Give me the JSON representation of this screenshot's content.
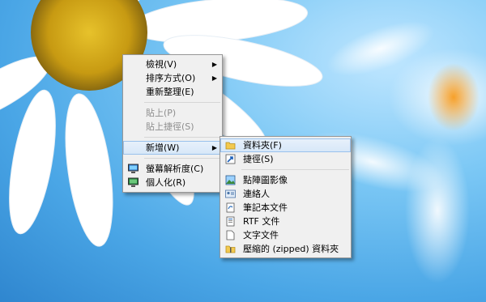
{
  "context_menu": {
    "items": [
      {
        "label": "檢視(V)",
        "submenu": true,
        "disabled": false
      },
      {
        "label": "排序方式(O)",
        "submenu": true,
        "disabled": false
      },
      {
        "label": "重新整理(E)",
        "submenu": false,
        "disabled": false
      },
      {
        "label": "貼上(P)",
        "submenu": false,
        "disabled": true
      },
      {
        "label": "貼上捷徑(S)",
        "submenu": false,
        "disabled": true
      },
      {
        "label": "新增(W)",
        "submenu": true,
        "disabled": false
      },
      {
        "label": "螢幕解析度(C)",
        "icon": "display-icon"
      },
      {
        "label": "個人化(R)",
        "icon": "personalize-icon"
      }
    ]
  },
  "new_submenu": {
    "items": [
      {
        "label": "資料夾(F)",
        "icon": "folder-icon"
      },
      {
        "label": "捷徑(S)",
        "icon": "shortcut-icon"
      },
      {
        "label": "點陣圖影像",
        "icon": "bitmap-icon"
      },
      {
        "label": "連絡人",
        "icon": "contact-icon"
      },
      {
        "label": "筆記本文件",
        "icon": "journal-icon"
      },
      {
        "label": "RTF 文件",
        "icon": "rtf-document-icon"
      },
      {
        "label": "文字文件",
        "icon": "text-document-icon"
      },
      {
        "label": "壓縮的 (zipped) 資料夾",
        "icon": "zip-folder-icon"
      }
    ]
  },
  "colors": {
    "highlight": "#d6e7f8",
    "highlight_border": "#99c1ec",
    "menu_bg": "#f0f0f0",
    "disabled_text": "#8d8d8d"
  }
}
